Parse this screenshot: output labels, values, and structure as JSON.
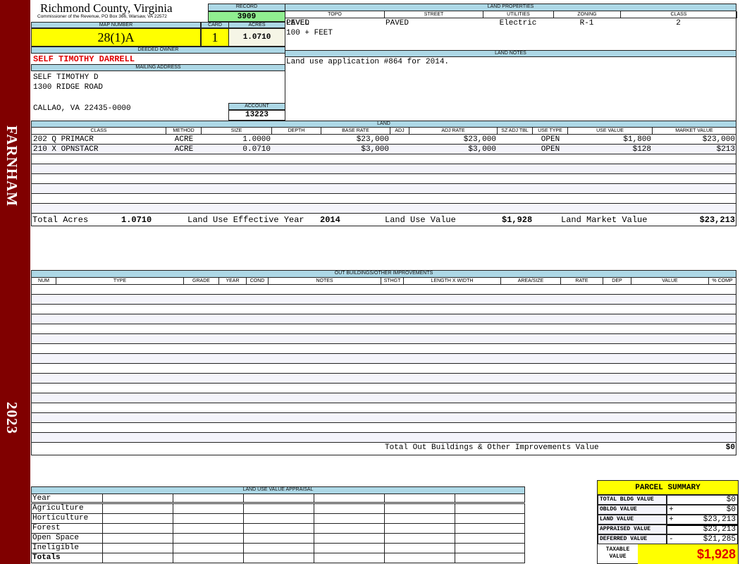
{
  "sidebar": {
    "district": "FARNHAM",
    "year": "2023",
    "color": "#800000"
  },
  "header": {
    "county": "Richmond County, Virginia",
    "subtitle": "Commissioner of the Revenue, PO Box 366, Warsaw, VA 22572",
    "record_label": "RECORD",
    "record": "3909",
    "map_label": "MAP NUMBER",
    "map_number": "28(1)A",
    "card_label": "CARD",
    "card": "1",
    "acres_label": "ACRES",
    "acres": "1.0710"
  },
  "owner": {
    "label": "DEEDED OWNER",
    "name": "SELF TIMOTHY DARRELL",
    "mailing_label": "MAILING ADDRESS",
    "lines": [
      "SELF TIMOTHY D",
      "1300 RIDGE ROAD",
      "CALLAO, VA 22435-0000"
    ],
    "account_label": "ACCOUNT",
    "account": "13223"
  },
  "land_properties": {
    "label": "LAND PROPERTIES",
    "headers": [
      "TOPO",
      "STREET",
      "UTILITIES",
      "ZONING",
      "CLASS"
    ],
    "values": [
      "LEVEL",
      "PAVED",
      "Electric",
      "R-1",
      "2"
    ],
    "extra": [
      "PAVED",
      "100 + FEET"
    ]
  },
  "land_notes": {
    "label": "LAND NOTES",
    "text": "Land use application #864 for 2014."
  },
  "land": {
    "label": "LAND",
    "headers": [
      "CLASS",
      "METHOD",
      "SIZE",
      "DEPTH",
      "BASE RATE",
      "ADJ",
      "ADJ RATE",
      "SZ ADJ TBL",
      "USE TYPE",
      "USE VALUE",
      "MARKET VALUE"
    ],
    "rows": [
      [
        "202 Q PRIMACR",
        "ACRE",
        "1.0000",
        "",
        "$23,000",
        "",
        "$23,000",
        "",
        "OPEN",
        "$1,800",
        "$23,000"
      ],
      [
        "210 X OPNSTACR",
        "ACRE",
        "0.0710",
        "",
        "$3,000",
        "",
        "$3,000",
        "",
        "OPEN",
        "$128",
        "$213"
      ]
    ],
    "totals": {
      "acres_label": "Total Acres",
      "acres": "1.0710",
      "year_label": "Land Use Effective Year",
      "year": "2014",
      "use_label": "Land Use Value",
      "use": "$1,928",
      "market_label": "Land Market Value",
      "market": "$23,213"
    }
  },
  "outbuildings": {
    "label": "OUT BUILDINGS/OTHER IMPROVEMENTS",
    "headers": [
      "NUM",
      "TYPE",
      "GRADE",
      "YEAR",
      "COND",
      "NOTES",
      "STHGT",
      "LENGTH X WIDTH",
      "AREA/SIZE",
      "RATE",
      "DEP",
      "VALUE",
      "% COMP"
    ],
    "total_label": "Total Out Buildings & Other Improvements Value",
    "total": "$0"
  },
  "land_use": {
    "label": "LAND USE VALUE APPRAISAL",
    "year_label": "Year",
    "rows": [
      "Agriculture",
      "Horticulture",
      "Forest",
      "Open Space",
      "Ineligible"
    ],
    "totals_label": "Totals"
  },
  "summary": {
    "title": "PARCEL SUMMARY",
    "rows": [
      {
        "label": "TOTAL BLDG VALUE",
        "op": "",
        "value": "$0"
      },
      {
        "label": "OBLDG VALUE",
        "op": "+",
        "value": "$0"
      },
      {
        "label": "LAND VALUE",
        "op": "+",
        "value": "$23,213"
      },
      {
        "label": "APPRAISED VALUE",
        "op": "",
        "value": "$23,213"
      },
      {
        "label": "DEFERRED VALUE",
        "op": "-",
        "value": "$21,285"
      }
    ],
    "taxable_label": "TAXABLE VALUE",
    "taxable": "$1,928"
  }
}
